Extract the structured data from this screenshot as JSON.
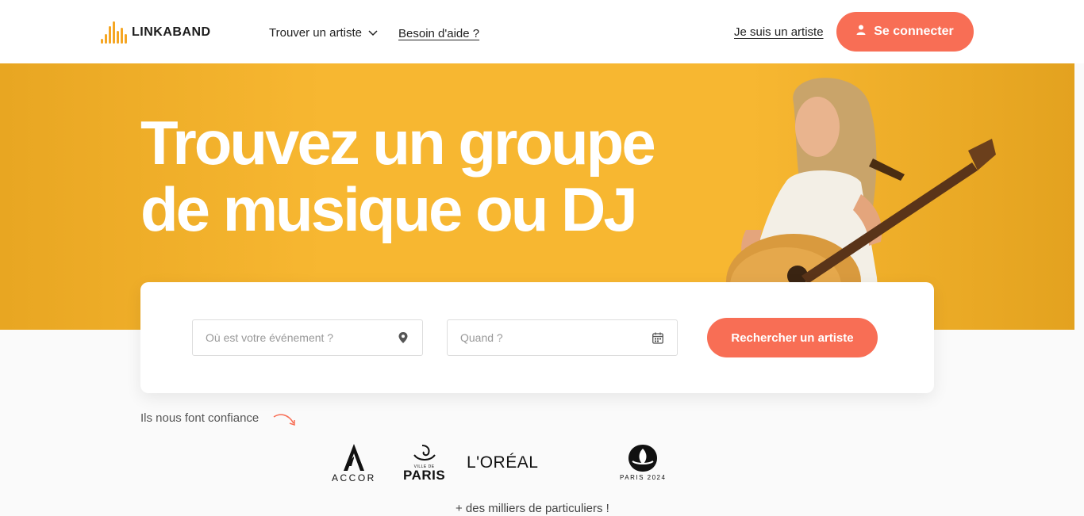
{
  "header": {
    "logo_text": "LINKABAND",
    "nav_find": "Trouver un artiste",
    "nav_help": "Besoin d'aide ?",
    "nav_artist": "Je suis un artiste",
    "login_label": "Se connecter"
  },
  "hero": {
    "title_line1": "Trouvez un groupe",
    "title_line2": "de musique ou DJ"
  },
  "search": {
    "where_placeholder": "Où est votre événement ?",
    "when_placeholder": "Quand ?",
    "button_label": "Rechercher un artiste"
  },
  "trust": {
    "label": "Ils nous font confiance",
    "accor": "ACCOR",
    "paris_small": "VILLE DE",
    "paris_big": "PARIS",
    "loreal": "L'ORÉAL",
    "paris2024": "PARIS 2024",
    "more": "+ des milliers de particuliers !"
  },
  "colors": {
    "accent": "#f86e55",
    "hero_yellow": "#f7b731",
    "logo_orange": "#f5a623"
  },
  "icons": {
    "nav_find": "chevron-down-icon",
    "login": "user-icon",
    "where": "map-pin-icon",
    "when": "calendar-icon"
  }
}
